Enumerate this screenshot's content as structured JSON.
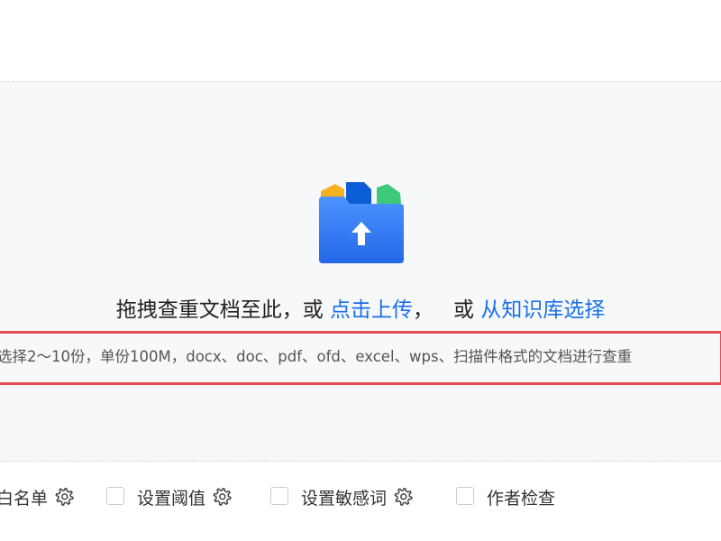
{
  "upload": {
    "prompt_prefix": "拖拽查重文档至此，或",
    "upload_link": "点击上传",
    "separator": "，",
    "prompt_or": "或",
    "kb_link": "从知识库选择",
    "description": "选择2～10份，单份100M，docx、doc、pdf、ofd、excel、wps、扫描件格式的文档进行查重"
  },
  "options": [
    {
      "label": "白名单",
      "icon": "gear-icon"
    },
    {
      "label": "设置阈值",
      "icon": "gear-icon"
    },
    {
      "label": "设置敏感词",
      "icon": "gear-icon"
    },
    {
      "label": "作者检查"
    }
  ],
  "colors": {
    "link": "#1a6fe6",
    "highlight_border": "#e24a56",
    "folder_blue": "#2d7cf6",
    "doc_yellow": "#f6b01e",
    "doc_green": "#3fc97b"
  }
}
